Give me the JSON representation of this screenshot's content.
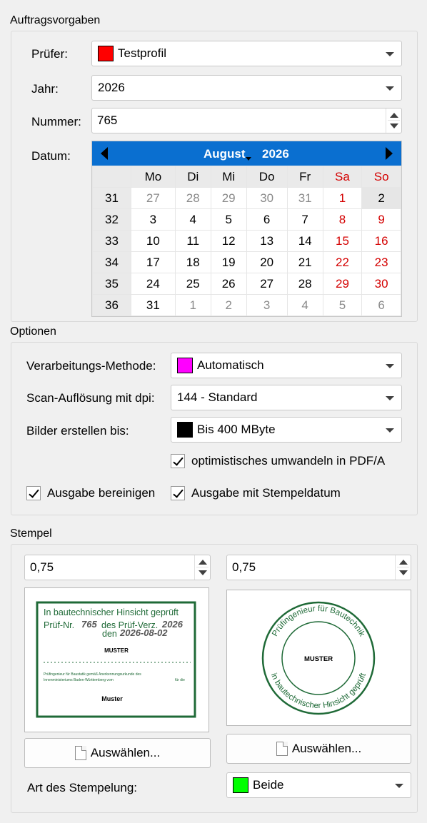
{
  "auftrag": {
    "title": "Auftragsvorgaben",
    "pruefer_label": "Prüfer:",
    "pruefer_value": "Testprofil",
    "pruefer_color": "#ff0000",
    "jahr_label": "Jahr:",
    "jahr_value": "2026",
    "nummer_label": "Nummer:",
    "nummer_value": "765",
    "datum_label": "Datum:"
  },
  "calendar": {
    "month": "August",
    "year": "2026",
    "weekdays": [
      "Mo",
      "Di",
      "Mi",
      "Do",
      "Fr",
      "Sa",
      "So"
    ],
    "weeks": [
      {
        "week": "31",
        "days": [
          "27",
          "28",
          "29",
          "30",
          "31",
          "1",
          "2"
        ]
      },
      {
        "week": "32",
        "days": [
          "3",
          "4",
          "5",
          "6",
          "7",
          "8",
          "9"
        ]
      },
      {
        "week": "33",
        "days": [
          "10",
          "11",
          "12",
          "13",
          "14",
          "15",
          "16"
        ]
      },
      {
        "week": "34",
        "days": [
          "17",
          "18",
          "19",
          "20",
          "21",
          "22",
          "23"
        ]
      },
      {
        "week": "35",
        "days": [
          "24",
          "25",
          "26",
          "27",
          "28",
          "29",
          "30"
        ]
      },
      {
        "week": "36",
        "days": [
          "31",
          "1",
          "2",
          "3",
          "4",
          "5",
          "6"
        ]
      }
    ],
    "selected_day": "2"
  },
  "optionen": {
    "title": "Optionen",
    "methode_label": "Verarbeitungs-Methode:",
    "methode_value": "Automatisch",
    "methode_color": "#ff00ff",
    "scan_label": "Scan-Auflösung mit dpi:",
    "scan_value": "144 - Standard",
    "bilder_label": "Bilder erstellen bis:",
    "bilder_value": "Bis 400 MByte",
    "bilder_color": "#000000",
    "check_pdfa": "optimistisches umwandeln in PDF/A",
    "check_bereinigen": "Ausgabe bereinigen",
    "check_stempeldatum": "Ausgabe mit Stempeldatum"
  },
  "stempel": {
    "title": "Stempel",
    "scale_left": "0,75",
    "scale_right": "0,75",
    "select_button": "Auswählen...",
    "art_label": "Art des Stempelung:",
    "art_value": "Beide",
    "art_color": "#00ff00",
    "rect_stamp": {
      "line1": "In bautechnischer Hinsicht geprüft",
      "line2_prefix": "Prüf-Nr.",
      "line2_nr": "765",
      "line2_mid": "des Prüf-Verz.",
      "line2_year": "2026",
      "line3_prefix": "den",
      "line3_date": "2026-08-02",
      "muster": "MUSTER",
      "fine1": "Prüfingenieur für Baustatik gemäß Anerkennungsurkunde des",
      "fine2": "Innenministeriums Baden-Württemberg vom",
      "fine2_end": "für die",
      "muster2": "Muster"
    },
    "round_stamp": {
      "top_text": "Prüfingenieur für Bautechnik",
      "bottom_text": "in bautechnischer Hinsicht geprüft",
      "center": "MUSTER"
    }
  }
}
